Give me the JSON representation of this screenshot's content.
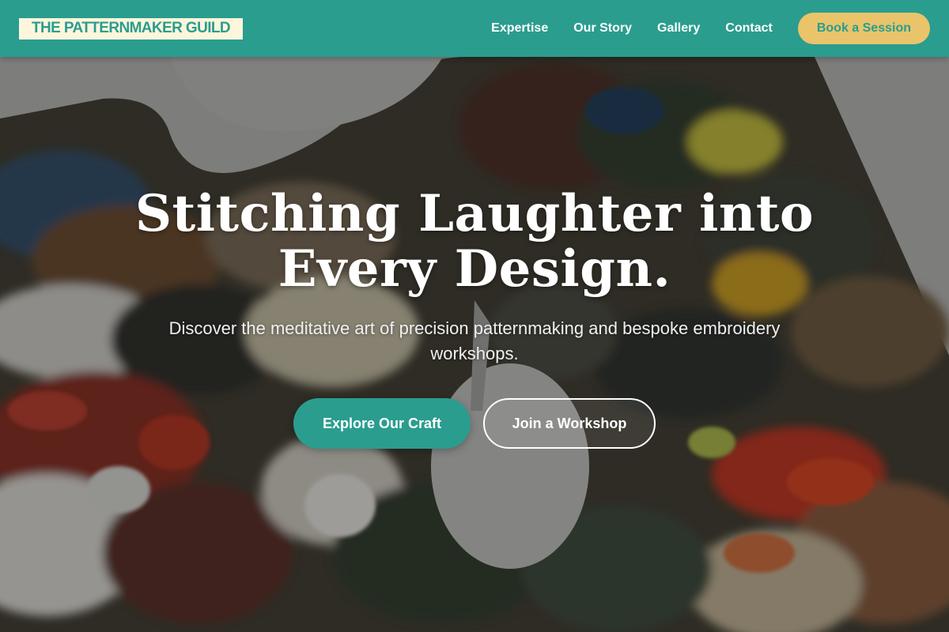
{
  "brand": {
    "logo_text": "THE PATTERNMAKER GUILD"
  },
  "nav": {
    "links": [
      {
        "label": "Expertise"
      },
      {
        "label": "Our Story"
      },
      {
        "label": "Gallery"
      },
      {
        "label": "Contact"
      }
    ],
    "cta_label": "Book a Session"
  },
  "hero": {
    "title": "Stitching Laughter into Every Design.",
    "subtitle": "Discover the meditative art of precision patternmaking and bespoke embroidery workshops.",
    "primary_button": "Explore Our Craft",
    "secondary_button": "Join a Workshop",
    "background_image": "paint-palette-photo"
  },
  "colors": {
    "primary_teal": "#2a9d8f",
    "accent_gold": "#e9c46a",
    "logo_bg_cream": "#fdf6dc",
    "text_white": "#ffffff"
  }
}
